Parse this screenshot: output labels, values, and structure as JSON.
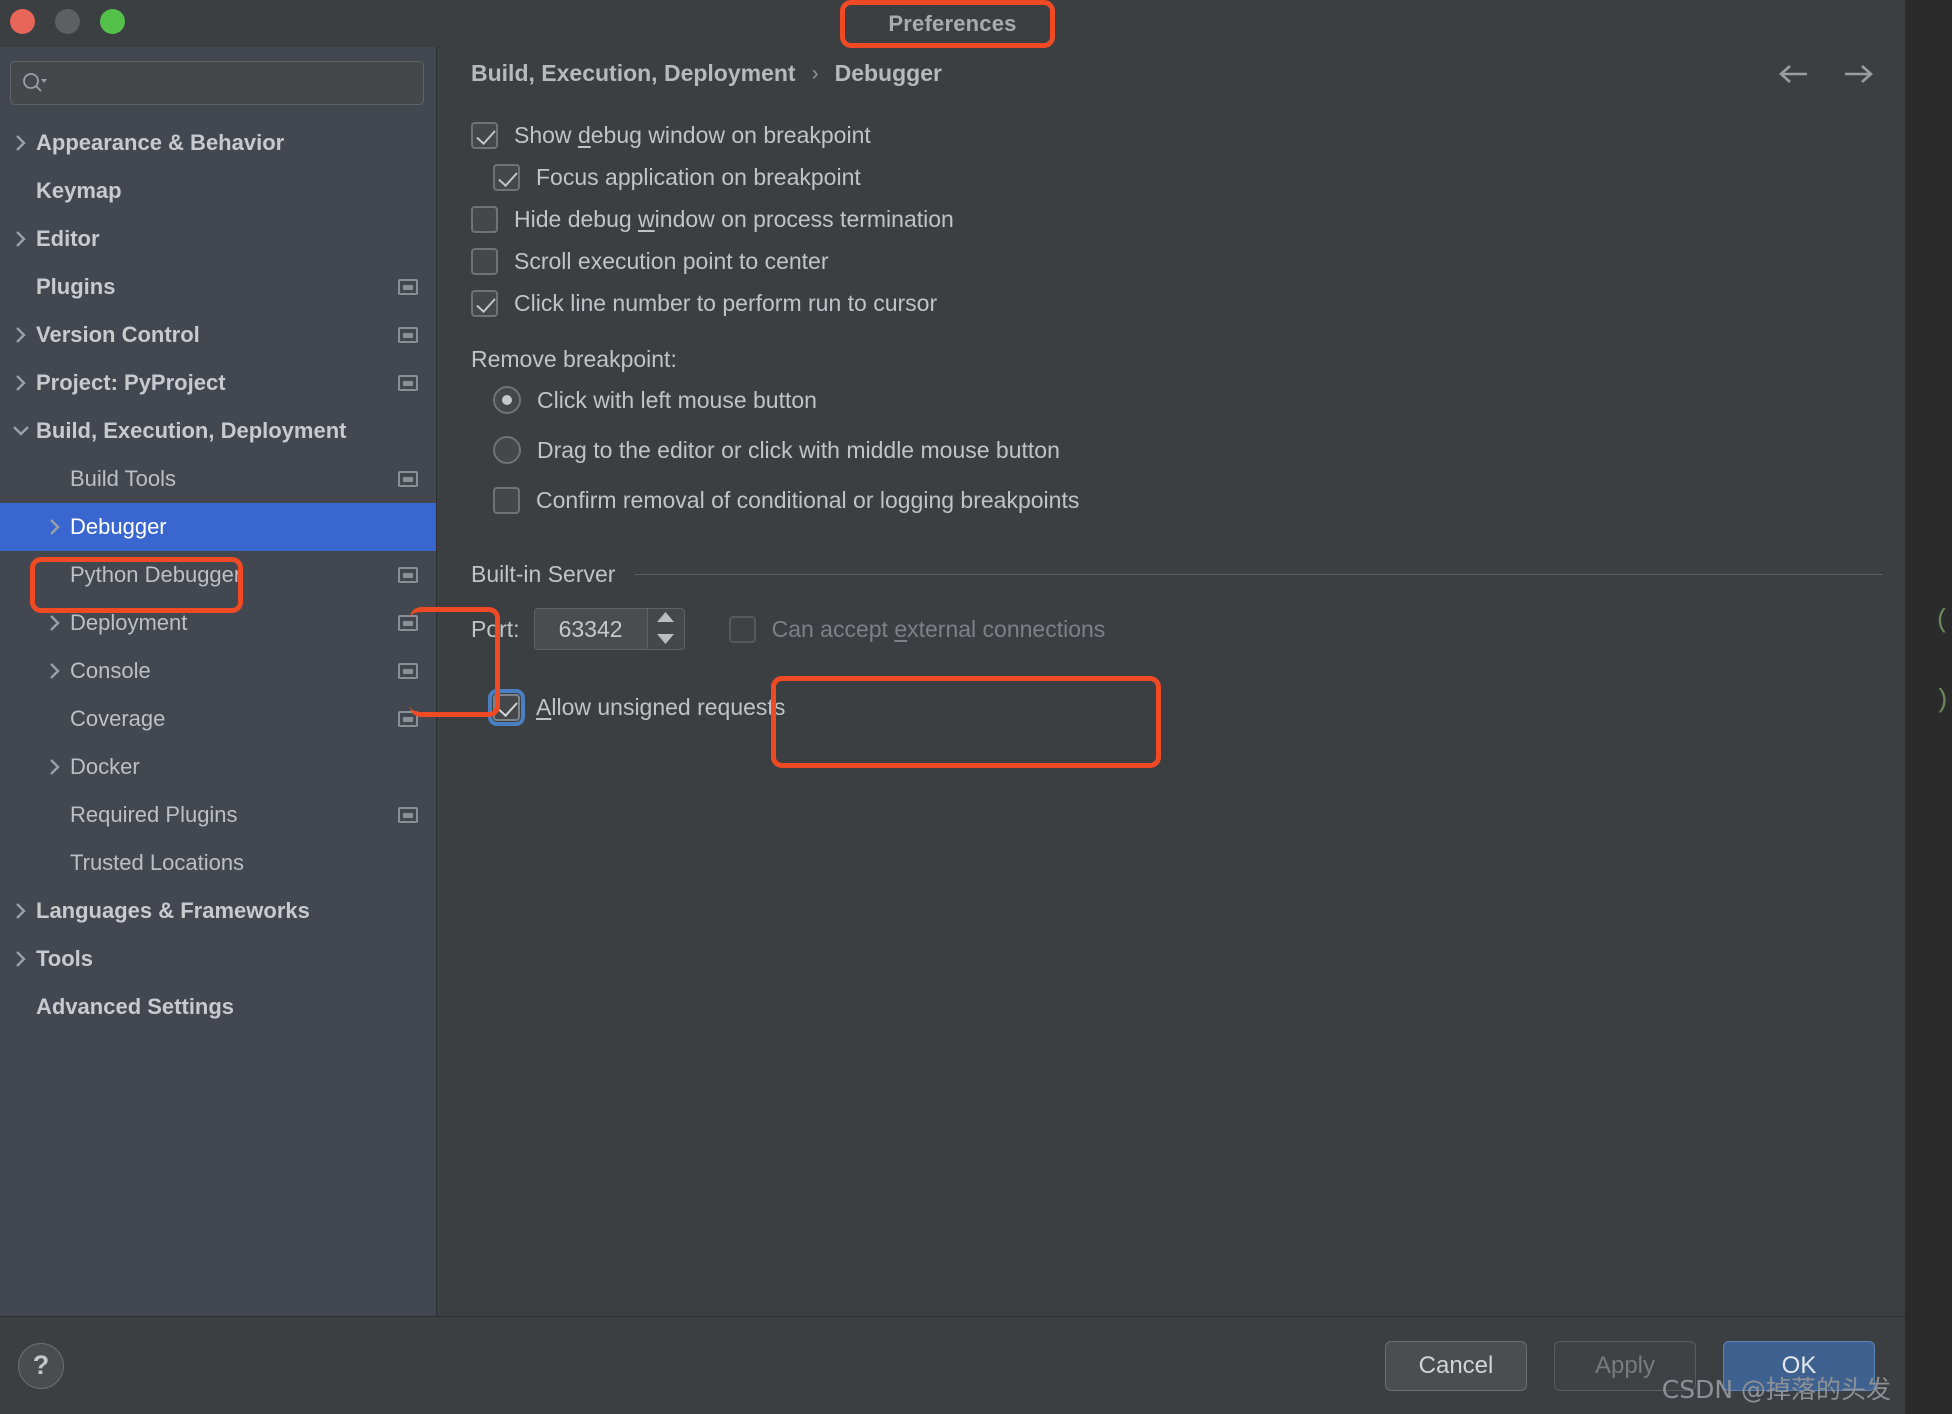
{
  "window": {
    "title": "Preferences",
    "traffic_lights": [
      "close-red",
      "minimize-yellow",
      "zoom-green"
    ]
  },
  "sidebar": {
    "search": {
      "value": "",
      "placeholder": ""
    },
    "items": [
      {
        "label": "Appearance & Behavior",
        "indent": 0,
        "bold": true,
        "twisty": "collapsed",
        "project_icon": false,
        "selected": false
      },
      {
        "label": "Keymap",
        "indent": 0,
        "bold": true,
        "twisty": "none",
        "project_icon": false,
        "selected": false
      },
      {
        "label": "Editor",
        "indent": 0,
        "bold": true,
        "twisty": "collapsed",
        "project_icon": false,
        "selected": false
      },
      {
        "label": "Plugins",
        "indent": 0,
        "bold": true,
        "twisty": "none",
        "project_icon": true,
        "selected": false
      },
      {
        "label": "Version Control",
        "indent": 0,
        "bold": true,
        "twisty": "collapsed",
        "project_icon": true,
        "selected": false
      },
      {
        "label": "Project: PyProject",
        "indent": 0,
        "bold": true,
        "twisty": "collapsed",
        "project_icon": true,
        "selected": false
      },
      {
        "label": "Build, Execution, Deployment",
        "indent": 0,
        "bold": true,
        "twisty": "expanded",
        "project_icon": false,
        "selected": false
      },
      {
        "label": "Build Tools",
        "indent": 1,
        "bold": false,
        "twisty": "none",
        "project_icon": true,
        "selected": false
      },
      {
        "label": "Debugger",
        "indent": 1,
        "bold": false,
        "twisty": "collapsed",
        "project_icon": false,
        "selected": true
      },
      {
        "label": "Python Debugger",
        "indent": 1,
        "bold": false,
        "twisty": "none",
        "project_icon": true,
        "selected": false
      },
      {
        "label": "Deployment",
        "indent": 1,
        "bold": false,
        "twisty": "collapsed",
        "project_icon": true,
        "selected": false
      },
      {
        "label": "Console",
        "indent": 1,
        "bold": false,
        "twisty": "collapsed",
        "project_icon": true,
        "selected": false
      },
      {
        "label": "Coverage",
        "indent": 1,
        "bold": false,
        "twisty": "none",
        "project_icon": true,
        "selected": false
      },
      {
        "label": "Docker",
        "indent": 1,
        "bold": false,
        "twisty": "collapsed",
        "project_icon": false,
        "selected": false
      },
      {
        "label": "Required Plugins",
        "indent": 1,
        "bold": false,
        "twisty": "none",
        "project_icon": true,
        "selected": false
      },
      {
        "label": "Trusted Locations",
        "indent": 1,
        "bold": false,
        "twisty": "none",
        "project_icon": false,
        "selected": false
      },
      {
        "label": "Languages & Frameworks",
        "indent": 0,
        "bold": true,
        "twisty": "collapsed",
        "project_icon": false,
        "selected": false
      },
      {
        "label": "Tools",
        "indent": 0,
        "bold": true,
        "twisty": "collapsed",
        "project_icon": false,
        "selected": false
      },
      {
        "label": "Advanced Settings",
        "indent": 0,
        "bold": true,
        "twisty": "none",
        "project_icon": false,
        "selected": false
      }
    ]
  },
  "breadcrumb": {
    "root": "Build, Execution, Deployment",
    "separator": "›",
    "leaf": "Debugger"
  },
  "settings": {
    "checkboxes": [
      {
        "label_before": "Show ",
        "mnemonic": "d",
        "label_after": "ebug window on breakpoint",
        "checked": true,
        "indent": 0,
        "disabled": false
      },
      {
        "label_before": "Focus application on breakpoint",
        "mnemonic": "",
        "label_after": "",
        "checked": true,
        "indent": 1,
        "disabled": false
      },
      {
        "label_before": "Hide debug ",
        "mnemonic": "w",
        "label_after": "indow on process termination",
        "checked": false,
        "indent": 0,
        "disabled": false
      },
      {
        "label_before": "Scroll execution point to center",
        "mnemonic": "",
        "label_after": "",
        "checked": false,
        "indent": 0,
        "disabled": false
      },
      {
        "label_before": "Click line number to perform run to cursor",
        "mnemonic": "",
        "label_after": "",
        "checked": true,
        "indent": 0,
        "disabled": false
      }
    ],
    "remove_breakpoint_label": "Remove breakpoint:",
    "radios": [
      {
        "label": "Click with left mouse button",
        "checked": true
      },
      {
        "label": "Drag to the editor or click with middle mouse button",
        "checked": false
      }
    ],
    "confirm_removal": {
      "label": "Confirm removal of conditional or logging breakpoints",
      "checked": false
    }
  },
  "builtin_server": {
    "section_title": "Built-in Server",
    "port_label": "Port:",
    "port_value": "63342",
    "external_connections": {
      "label_before": "Can accept ",
      "mnemonic": "e",
      "label_after": "xternal connections",
      "checked": false,
      "disabled": true
    },
    "allow_unsigned": {
      "label_before": "",
      "mnemonic": "A",
      "label_after": "llow unsigned requests",
      "checked": true,
      "focused": true
    }
  },
  "footer": {
    "help_glyph": "?",
    "cancel_label": "Cancel",
    "apply_label": "Apply",
    "ok_label": "OK"
  },
  "watermark": "CSDN @掉落的头发",
  "background_code": [
    "(",
    ")"
  ],
  "colors": {
    "window_bg": "#3c3f41",
    "sidebar_bg": "#43474f",
    "selection_blue": "#3a67cf",
    "annotation_red": "#f04a24",
    "primary_button": "#3f618f",
    "focus_ring": "#4a7fc1",
    "text": "#c0c4c7",
    "text_dim": "#7c8185",
    "editor_green": "#6a8759"
  }
}
